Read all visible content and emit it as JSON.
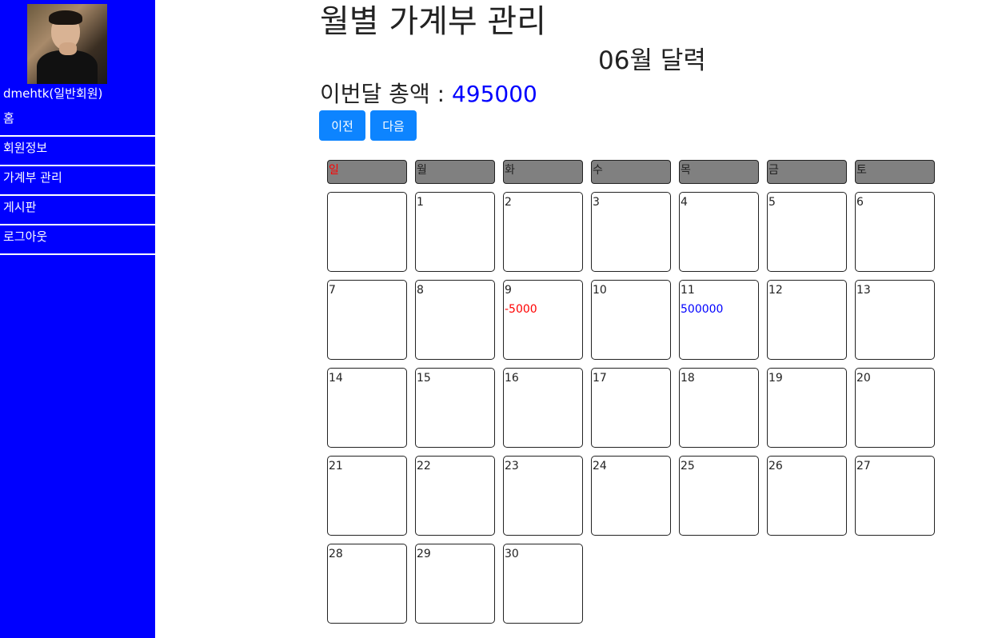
{
  "sidebar": {
    "username": "dmehtk(일반회원)",
    "menu": [
      {
        "label": "홈"
      },
      {
        "label": "회원정보"
      },
      {
        "label": "가계부 관리"
      },
      {
        "label": "게시판"
      },
      {
        "label": "로그아웃"
      }
    ]
  },
  "main": {
    "title": "월별 가계부 관리",
    "month_title": "06월 달력",
    "total_label": "이번달 총액 : ",
    "total_amount": "495000",
    "prev_label": "이전",
    "next_label": "다음"
  },
  "calendar": {
    "weekdays": [
      "일",
      "월",
      "화",
      "수",
      "목",
      "금",
      "토"
    ],
    "weeks": [
      [
        {
          "day": ""
        },
        {
          "day": "1"
        },
        {
          "day": "2"
        },
        {
          "day": "3"
        },
        {
          "day": "4"
        },
        {
          "day": "5"
        },
        {
          "day": "6"
        }
      ],
      [
        {
          "day": "7"
        },
        {
          "day": "8"
        },
        {
          "day": "9",
          "amount": "-5000",
          "type": "neg"
        },
        {
          "day": "10"
        },
        {
          "day": "11",
          "amount": "500000",
          "type": "pos"
        },
        {
          "day": "12"
        },
        {
          "day": "13"
        }
      ],
      [
        {
          "day": "14"
        },
        {
          "day": "15"
        },
        {
          "day": "16"
        },
        {
          "day": "17"
        },
        {
          "day": "18"
        },
        {
          "day": "19"
        },
        {
          "day": "20"
        }
      ],
      [
        {
          "day": "21"
        },
        {
          "day": "22"
        },
        {
          "day": "23"
        },
        {
          "day": "24"
        },
        {
          "day": "25"
        },
        {
          "day": "26"
        },
        {
          "day": "27"
        }
      ],
      [
        {
          "day": "28"
        },
        {
          "day": "29"
        },
        {
          "day": "30"
        }
      ]
    ]
  },
  "colors": {
    "sidebar_bg": "#0000ff",
    "button_bg": "#0d84ff",
    "negative": "#ff0000",
    "positive": "#0000ff",
    "header_bg": "#808080"
  }
}
